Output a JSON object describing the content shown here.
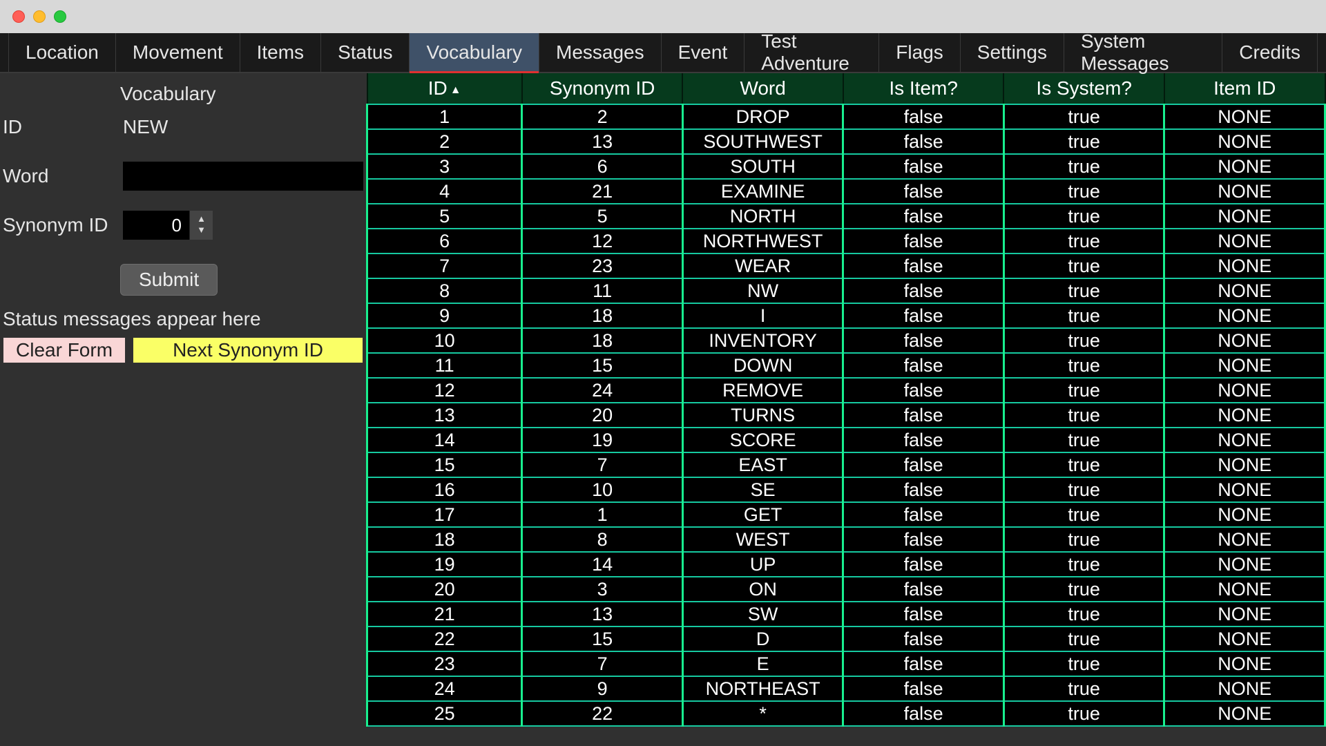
{
  "tabs": [
    {
      "label": "Location"
    },
    {
      "label": "Movement"
    },
    {
      "label": "Items"
    },
    {
      "label": "Status"
    },
    {
      "label": "Vocabulary",
      "active": true
    },
    {
      "label": "Messages"
    },
    {
      "label": "Event"
    },
    {
      "label": "Test Adventure"
    },
    {
      "label": "Flags"
    },
    {
      "label": "Settings"
    },
    {
      "label": "System Messages"
    },
    {
      "label": "Credits"
    }
  ],
  "section": {
    "title": "Vocabulary"
  },
  "form": {
    "id_label": "ID",
    "id_value": "NEW",
    "word_label": "Word",
    "word_value": "",
    "synonym_label": "Synonym ID",
    "synonym_value": "0",
    "submit_label": "Submit",
    "status_text": "Status messages appear here",
    "clear_label": "Clear Form",
    "next_label": "Next Synonym ID"
  },
  "table": {
    "sort_indicator": "▲",
    "headers": [
      "ID",
      "Synonym ID",
      "Word",
      "Is Item?",
      "Is System?",
      "Item ID"
    ],
    "rows": [
      {
        "id": "1",
        "syn": "2",
        "word": "DROP",
        "isItem": "false",
        "isSystem": "true",
        "itemId": "NONE"
      },
      {
        "id": "2",
        "syn": "13",
        "word": "SOUTHWEST",
        "isItem": "false",
        "isSystem": "true",
        "itemId": "NONE"
      },
      {
        "id": "3",
        "syn": "6",
        "word": "SOUTH",
        "isItem": "false",
        "isSystem": "true",
        "itemId": "NONE"
      },
      {
        "id": "4",
        "syn": "21",
        "word": "EXAMINE",
        "isItem": "false",
        "isSystem": "true",
        "itemId": "NONE"
      },
      {
        "id": "5",
        "syn": "5",
        "word": "NORTH",
        "isItem": "false",
        "isSystem": "true",
        "itemId": "NONE"
      },
      {
        "id": "6",
        "syn": "12",
        "word": "NORTHWEST",
        "isItem": "false",
        "isSystem": "true",
        "itemId": "NONE"
      },
      {
        "id": "7",
        "syn": "23",
        "word": "WEAR",
        "isItem": "false",
        "isSystem": "true",
        "itemId": "NONE"
      },
      {
        "id": "8",
        "syn": "11",
        "word": "NW",
        "isItem": "false",
        "isSystem": "true",
        "itemId": "NONE"
      },
      {
        "id": "9",
        "syn": "18",
        "word": "I",
        "isItem": "false",
        "isSystem": "true",
        "itemId": "NONE"
      },
      {
        "id": "10",
        "syn": "18",
        "word": "INVENTORY",
        "isItem": "false",
        "isSystem": "true",
        "itemId": "NONE"
      },
      {
        "id": "11",
        "syn": "15",
        "word": "DOWN",
        "isItem": "false",
        "isSystem": "true",
        "itemId": "NONE"
      },
      {
        "id": "12",
        "syn": "24",
        "word": "REMOVE",
        "isItem": "false",
        "isSystem": "true",
        "itemId": "NONE"
      },
      {
        "id": "13",
        "syn": "20",
        "word": "TURNS",
        "isItem": "false",
        "isSystem": "true",
        "itemId": "NONE"
      },
      {
        "id": "14",
        "syn": "19",
        "word": "SCORE",
        "isItem": "false",
        "isSystem": "true",
        "itemId": "NONE"
      },
      {
        "id": "15",
        "syn": "7",
        "word": "EAST",
        "isItem": "false",
        "isSystem": "true",
        "itemId": "NONE"
      },
      {
        "id": "16",
        "syn": "10",
        "word": "SE",
        "isItem": "false",
        "isSystem": "true",
        "itemId": "NONE"
      },
      {
        "id": "17",
        "syn": "1",
        "word": "GET",
        "isItem": "false",
        "isSystem": "true",
        "itemId": "NONE"
      },
      {
        "id": "18",
        "syn": "8",
        "word": "WEST",
        "isItem": "false",
        "isSystem": "true",
        "itemId": "NONE"
      },
      {
        "id": "19",
        "syn": "14",
        "word": "UP",
        "isItem": "false",
        "isSystem": "true",
        "itemId": "NONE"
      },
      {
        "id": "20",
        "syn": "3",
        "word": "ON",
        "isItem": "false",
        "isSystem": "true",
        "itemId": "NONE"
      },
      {
        "id": "21",
        "syn": "13",
        "word": "SW",
        "isItem": "false",
        "isSystem": "true",
        "itemId": "NONE"
      },
      {
        "id": "22",
        "syn": "15",
        "word": "D",
        "isItem": "false",
        "isSystem": "true",
        "itemId": "NONE"
      },
      {
        "id": "23",
        "syn": "7",
        "word": "E",
        "isItem": "false",
        "isSystem": "true",
        "itemId": "NONE"
      },
      {
        "id": "24",
        "syn": "9",
        "word": "NORTHEAST",
        "isItem": "false",
        "isSystem": "true",
        "itemId": "NONE"
      },
      {
        "id": "25",
        "syn": "22",
        "word": "*",
        "isItem": "false",
        "isSystem": "true",
        "itemId": "NONE"
      }
    ]
  }
}
